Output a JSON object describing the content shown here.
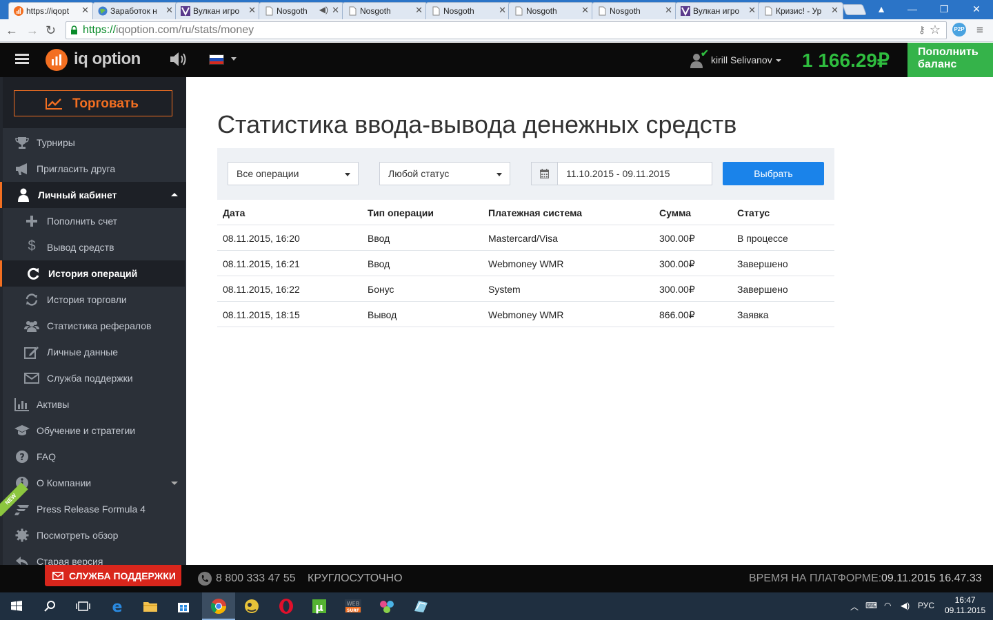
{
  "browser": {
    "tabs": [
      {
        "label": "https://iqopt",
        "icon": "iqoption-favicon",
        "active": true
      },
      {
        "label": "Заработок н",
        "icon": "globe-favicon"
      },
      {
        "label": "Вулкан игро",
        "icon": "vulkan-favicon"
      },
      {
        "label": "Nosgoth",
        "icon": "page-favicon",
        "audio": true
      },
      {
        "label": "Nosgoth",
        "icon": "page-favicon"
      },
      {
        "label": "Nosgoth",
        "icon": "page-favicon"
      },
      {
        "label": "Nosgoth",
        "icon": "page-favicon"
      },
      {
        "label": "Nosgoth",
        "icon": "page-favicon"
      },
      {
        "label": "Вулкан игро",
        "icon": "vulkan-favicon"
      },
      {
        "label": "Кризис! - Ур",
        "icon": "page-favicon"
      }
    ],
    "url_protocol": "https://",
    "url_rest": "iqoption.com/ru/stats/money",
    "extension_label": "P2P"
  },
  "header": {
    "logo_text": "iq option",
    "user_name": "kirill Selivanov",
    "balance": "1 166.29₽",
    "deposit_line1": "Пополнить",
    "deposit_line2": "баланс",
    "accent_color": "#f36f21",
    "balance_color": "#2fbd3f"
  },
  "sidebar": {
    "trade_label": "Торговать",
    "items": [
      {
        "label": "Турниры",
        "icon": "trophy-icon"
      },
      {
        "label": "Пригласить друга",
        "icon": "megaphone-icon"
      },
      {
        "label": "Личный кабинет",
        "icon": "user-icon"
      },
      {
        "label": "Пополнить счет",
        "icon": "plus-icon"
      },
      {
        "label": "Вывод средств",
        "icon": "dollar-icon"
      },
      {
        "label": "История операций",
        "icon": "refresh-icon"
      },
      {
        "label": "История торговли",
        "icon": "sync-icon"
      },
      {
        "label": "Статистика рефералов",
        "icon": "users-icon"
      },
      {
        "label": "Личные данные",
        "icon": "edit-icon"
      },
      {
        "label": "Служба поддержки",
        "icon": "envelope-icon"
      },
      {
        "label": "Активы",
        "icon": "bar-chart-icon"
      },
      {
        "label": "Обучение и стратегии",
        "icon": "graduation-cap-icon"
      },
      {
        "label": "FAQ",
        "icon": "question-icon"
      },
      {
        "label": "О Компании",
        "icon": "info-icon"
      },
      {
        "label": "Press Release Formula 4",
        "icon": "formula-icon"
      },
      {
        "label": "Посмотреть обзор",
        "icon": "gear-icon"
      },
      {
        "label": "Старая версия",
        "icon": "back-icon"
      }
    ],
    "new_badge": "NEW"
  },
  "main": {
    "title": "Статистика ввода-вывода денежных средств",
    "filters": {
      "operation": "Все операции",
      "status": "Любой статус",
      "date_range": "11.10.2015 - 09.11.2015",
      "submit": "Выбрать"
    },
    "table": {
      "columns": [
        "Дата",
        "Тип операции",
        "Платежная система",
        "Сумма",
        "Статус"
      ],
      "rows": [
        [
          "08.11.2015, 16:20",
          "Ввод",
          "Mastercard/Visa",
          "300.00₽",
          "В процессе"
        ],
        [
          "08.11.2015, 16:21",
          "Ввод",
          "Webmoney WMR",
          "300.00₽",
          "Завершено"
        ],
        [
          "08.11.2015, 16:22",
          "Бонус",
          "System",
          "300.00₽",
          "Завершено"
        ],
        [
          "08.11.2015, 18:15",
          "Вывод",
          "Webmoney WMR",
          "866.00₽",
          "Заявка"
        ]
      ]
    }
  },
  "footer": {
    "support_label": "СЛУЖБА ПОДДЕРЖКИ",
    "phone": "8 800 333 47 55",
    "hours": "КРУГЛОСУТОЧНО",
    "platform_time_label": "ВРЕМЯ НА ПЛАТФОРМЕ:",
    "platform_time": "09.11.2015 16.47.33"
  },
  "taskbar": {
    "language": "РУС",
    "time": "16:47",
    "date": "09.11.2015",
    "apps": [
      "start-icon",
      "search-icon",
      "task-view-icon",
      "edge-icon",
      "explorer-icon",
      "store-icon",
      "chrome-icon",
      "app-icon",
      "opera-icon",
      "utorrent-icon",
      "websurf-icon",
      "app2-icon",
      "app3-icon"
    ]
  }
}
